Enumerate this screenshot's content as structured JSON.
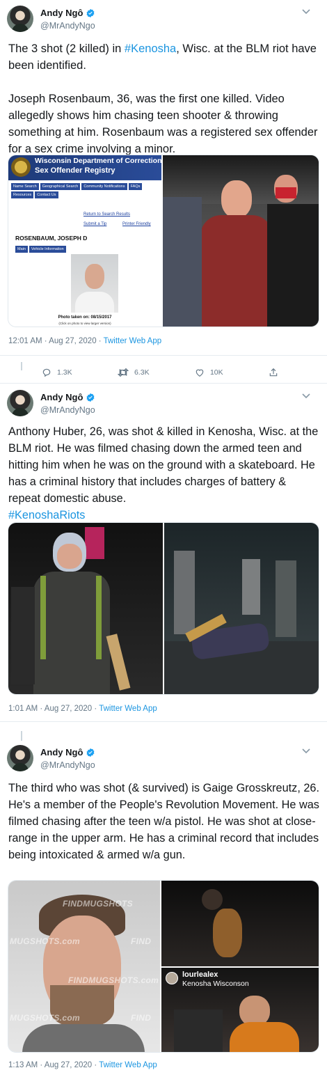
{
  "tweets": [
    {
      "author": {
        "name": "Andy Ngô",
        "handle": "@MrAndyNgo"
      },
      "text_parts": [
        "The 3 shot (2 killed) in ",
        "#Kenosha",
        ", Wisc. at the BLM riot have been identified.\n\nJoseph Rosenbaum, 36, was the first one killed. Video allegedly shows him chasing teen shooter & throwing something at him. Rosenbaum was a registered sex offender for a sex crime involving a minor."
      ],
      "media": {
        "registry": {
          "header1": "Wisconsin Department of Correction",
          "header2": "Sex Offender Registry",
          "nav": [
            "Name Search",
            "Geographical Search",
            "Community Notifications",
            "FAQs",
            "Resources",
            "Contact Us"
          ],
          "return_link": "Return to Search Results",
          "submit_tip": "Submit a Tip",
          "printer": "Printer Friendly",
          "person_name": "ROSENBAUM, JOSEPH D",
          "tabs": [
            "Main",
            "Vehicle Information"
          ],
          "photo_caption": "Photo taken on: 08/15/2017",
          "photo_sub": "(Click on photo to view larger version)"
        }
      },
      "timestamp": "12:01 AM · Aug 27, 2020 · ",
      "source_app": "Twitter Web App",
      "stats": {
        "replies": "1.3K",
        "retweets": "6.3K",
        "likes": "10K"
      }
    },
    {
      "author": {
        "name": "Andy Ngô",
        "handle": "@MrAndyNgo"
      },
      "text_parts": [
        "Anthony Huber, 26, was shot & killed in Kenosha, Wisc. at the BLM riot. He was filmed chasing down the armed teen and hitting him when he was on the ground with a skateboard. He has a criminal history that includes charges of battery & repeat domestic abuse.\n",
        "#KenoshaRiots",
        ""
      ],
      "timestamp": "1:01 AM · Aug 27, 2020 · ",
      "source_app": "Twitter Web App"
    },
    {
      "author": {
        "name": "Andy Ngô",
        "handle": "@MrAndyNgo"
      },
      "text_parts": [
        "The third who was shot (& survived) is Gaige Grosskreutz, 26. He's a member of the People's Revolution Movement. He was filmed chasing after the teen w/a pistol. He was shot at close-range in the upper arm. He has a criminal record that includes being intoxicated & armed w/a gun.",
        "",
        ""
      ],
      "media": {
        "watermarks": [
          "FINDMUGSHOTS",
          "MUGSHOTS.com",
          "FINDMUGSHOTS.com",
          "MUGSHOTS.com",
          "FIND",
          "FIND"
        ],
        "overlay_user": "lourlealex",
        "overlay_caption": "Kenosha Wisconson"
      },
      "timestamp": "1:13 AM · Aug 27, 2020 · ",
      "source_app": "Twitter Web App"
    }
  ],
  "colors": {
    "link": "#1b95e0",
    "muted": "#657786",
    "verified": "#1da1f2"
  }
}
